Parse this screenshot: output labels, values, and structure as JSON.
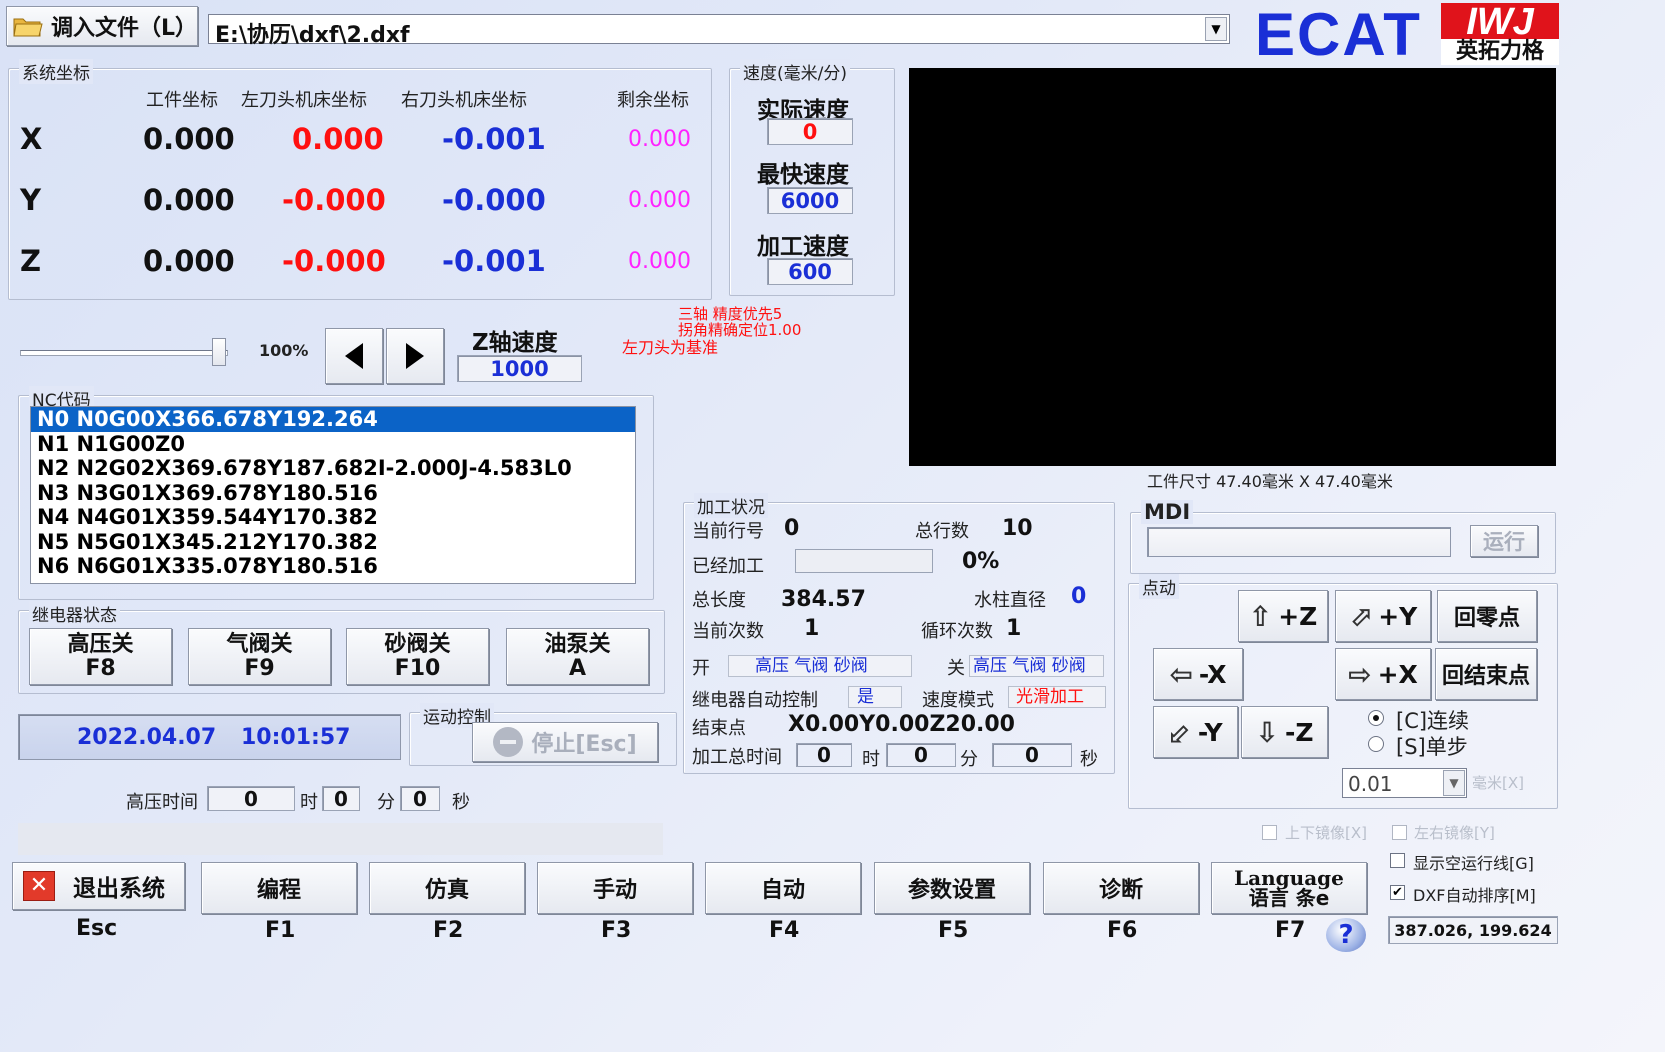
{
  "header": {
    "load_file_button": "调入文件（L）",
    "file_path": "E:\\协历\\dxf\\2.dxf",
    "brand_ecat": "ECAT",
    "brand_logo_text": "IWJ",
    "brand_company": "英拓力格"
  },
  "coords": {
    "group_label": "系统坐标",
    "headers": [
      "工件坐标",
      "左刀头机床坐标",
      "右刀头机床坐标",
      "剩余坐标"
    ],
    "rows": [
      {
        "axis": "X",
        "work": "0.000",
        "left": "0.000",
        "right": "-0.001",
        "remain": "0.000"
      },
      {
        "axis": "Y",
        "work": "0.000",
        "left": "-0.000",
        "right": "-0.000",
        "remain": "0.000"
      },
      {
        "axis": "Z",
        "work": "0.000",
        "left": "-0.000",
        "right": "-0.001",
        "remain": "0.000"
      }
    ]
  },
  "speed": {
    "group_label": "速度(毫米/分)",
    "actual_label": "实际速度",
    "actual_value": "0",
    "max_label": "最快速度",
    "max_value": "6000",
    "process_label": "加工速度",
    "process_value": "600"
  },
  "feed": {
    "percent_label": "100%",
    "percent_value": 1.0,
    "z_speed_label": "Z轴速度",
    "z_speed_value": "1000"
  },
  "status_notes": [
    "三轴 精度优先5",
    "拐角精确定位1.00",
    "左刀头为基准"
  ],
  "preview": {
    "workpiece_size": "工件尺寸 47.40毫米 X 47.40毫米"
  },
  "nc": {
    "group_label": "NC代码",
    "lines": [
      "N0 N0G00X366.678Y192.264",
      "N1 N1G00Z0",
      "N2 N2G02X369.678Y187.682I-2.000J-4.583L0",
      "N3 N3G01X369.678Y180.516",
      "N4 N4G01X359.544Y170.382",
      "N5 N5G01X345.212Y170.382",
      "N6 N6G01X335.078Y180.516"
    ]
  },
  "relay": {
    "group_label": "继电器状态",
    "buttons": [
      {
        "label": "高压关",
        "key": "F8"
      },
      {
        "label": "气阀关",
        "key": "F9"
      },
      {
        "label": "砂阀关",
        "key": "F10"
      },
      {
        "label": "油泵关",
        "key": "A"
      }
    ]
  },
  "clock": {
    "date": "2022.04.07",
    "time": "10:01:57"
  },
  "motion": {
    "group_label": "运动控制",
    "stop_button": "停止[Esc]"
  },
  "hv_time": {
    "label": "高压时间",
    "hours": "0",
    "h_unit": "时",
    "minutes": "0",
    "m_unit": "分",
    "seconds": "0",
    "s_unit": "秒"
  },
  "process": {
    "group_label": "加工状况",
    "current_line_label": "当前行号",
    "current_line": "0",
    "total_lines_label": "总行数",
    "total_lines": "10",
    "done_label": "已经加工",
    "done_percent": "0%",
    "done_fraction": 0,
    "total_length_label": "总长度",
    "total_length": "384.57",
    "jet_diameter_label": "水柱直径",
    "jet_diameter": "0",
    "current_count_label": "当前次数",
    "current_count": "1",
    "loop_count_label": "循环次数",
    "loop_count": "1",
    "open_label": "开",
    "open_items": "高压 气阀 砂阀",
    "close_label": "关",
    "close_items": "高压 气阀 砂阀",
    "relay_auto_label": "继电器自动控制",
    "relay_auto_value": "是",
    "speed_mode_label": "速度模式",
    "speed_mode_value": "光滑加工",
    "end_point_label": "结束点",
    "end_point_value": "X0.00Y0.00Z20.00",
    "total_time_label": "加工总时间",
    "time_h": "0",
    "time_h_unit": "时",
    "time_m": "0",
    "time_m_unit": "分",
    "time_s": "0",
    "time_s_unit": "秒"
  },
  "mdi": {
    "group_label": "MDI",
    "run_button": "运行"
  },
  "jog": {
    "group_label": "点动",
    "plus_z": "+Z",
    "plus_y": "+Y",
    "home": "回零点",
    "minus_x": "-X",
    "plus_x": "+X",
    "end_point": "回结束点",
    "minus_y": "-Y",
    "minus_z": "-Z",
    "continuous": "[C]连续",
    "single_step": "[S]单步",
    "step_value": "0.01",
    "step_unit": "毫米[X]"
  },
  "options": {
    "mirror_ud": "上下镜像[X]",
    "mirror_lr": "左右镜像[Y]",
    "show_empty_run": "显示空运行线[G]",
    "dxf_auto_sort": "DXF自动排序[M]",
    "cursor_coords": "387.026, 199.624"
  },
  "bottom": {
    "exit_label": "退出系统",
    "exit_key": "Esc",
    "buttons": [
      {
        "label": "编程",
        "key": "F1"
      },
      {
        "label": "仿真",
        "key": "F2"
      },
      {
        "label": "手动",
        "key": "F3"
      },
      {
        "label": "自动",
        "key": "F4"
      },
      {
        "label": "参数设置",
        "key": "F5"
      },
      {
        "label": "诊断",
        "key": "F6"
      }
    ],
    "lang_en": "Language",
    "lang_zh": "语言 条e",
    "lang_key": "F7"
  },
  "colors": {
    "accent_blue": "#1a2fd6",
    "red": "#ff1010",
    "magenta": "#ff22ff",
    "selection": "#0b63c7"
  }
}
